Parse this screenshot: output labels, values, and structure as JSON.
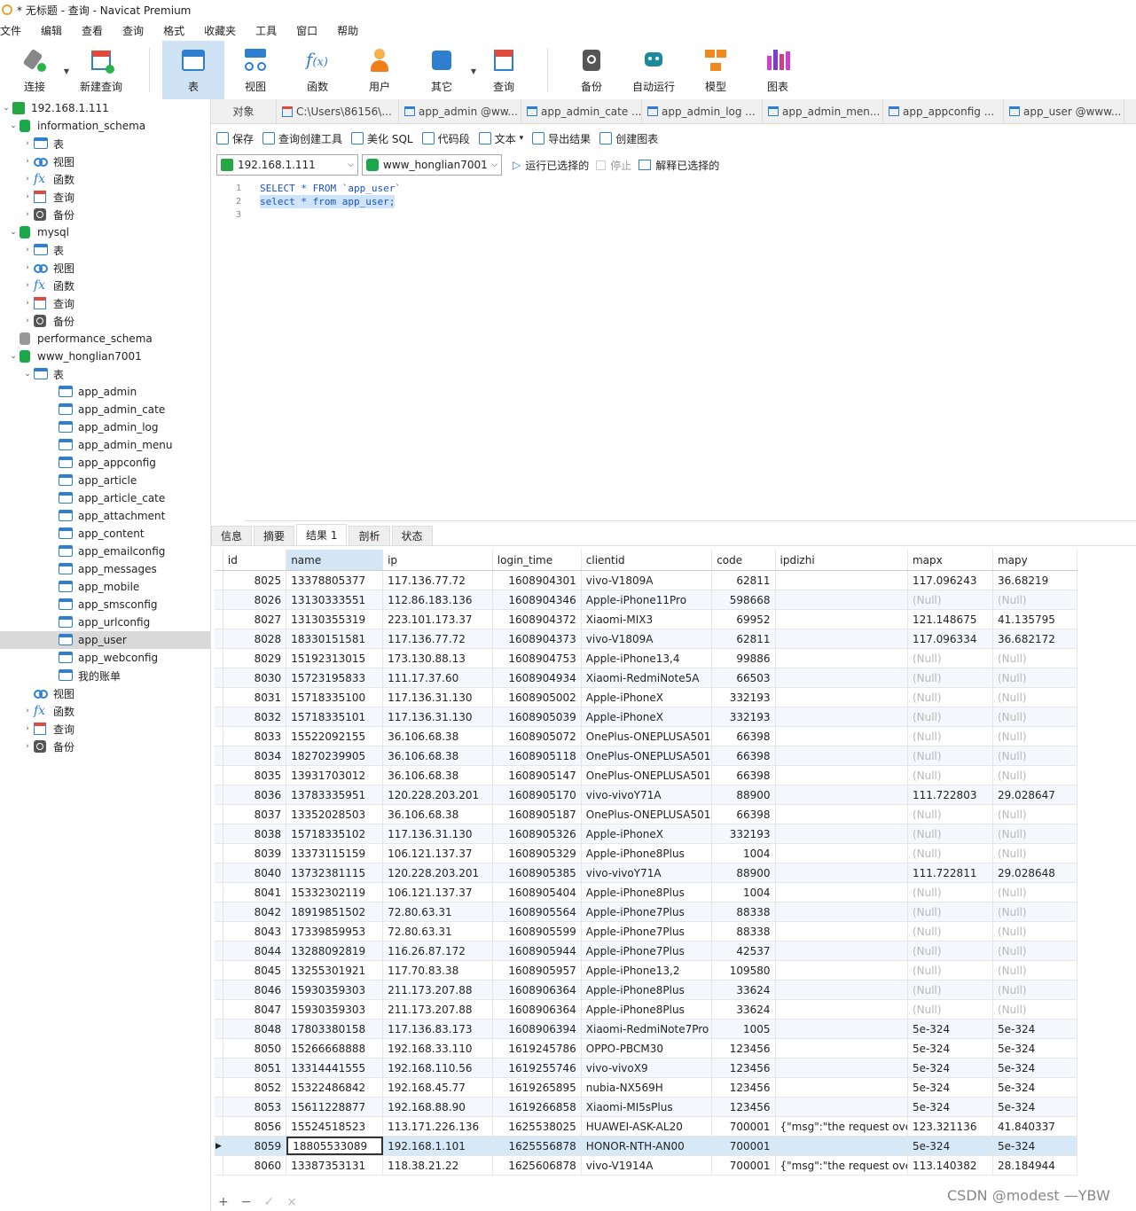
{
  "window": {
    "title": "* 无标题 - 查询 - Navicat Premium"
  },
  "menu": [
    "文件",
    "编辑",
    "查看",
    "查询",
    "格式",
    "收藏夹",
    "工具",
    "窗口",
    "帮助"
  ],
  "toolbar": [
    {
      "label": "连接",
      "icon": "connect-icon"
    },
    {
      "label": "新建查询",
      "icon": "new-query-icon"
    },
    {
      "label": "表",
      "icon": "table-icon"
    },
    {
      "label": "视图",
      "icon": "view-icon"
    },
    {
      "label": "函数",
      "icon": "function-icon"
    },
    {
      "label": "用户",
      "icon": "user-icon"
    },
    {
      "label": "其它",
      "icon": "tools-icon"
    },
    {
      "label": "查询",
      "icon": "query-icon"
    },
    {
      "label": "备份",
      "icon": "backup-icon"
    },
    {
      "label": "自动运行",
      "icon": "robot-icon"
    },
    {
      "label": "模型",
      "icon": "model-icon"
    },
    {
      "label": "图表",
      "icon": "chart-icon"
    }
  ],
  "sidebar": {
    "rows": [
      "192.168.1.111",
      "information_schema",
      "表",
      "视图",
      "函数",
      "查询",
      "备份",
      "mysql",
      "表",
      "视图",
      "函数",
      "查询",
      "备份",
      "performance_schema",
      "www_honglian7001",
      "表",
      "app_admin",
      "app_admin_cate",
      "app_admin_log",
      "app_admin_menu",
      "app_appconfig",
      "app_article",
      "app_article_cate",
      "app_attachment",
      "app_content",
      "app_emailconfig",
      "app_messages",
      "app_mobile",
      "app_smsconfig",
      "app_urlconfig",
      "app_user",
      "app_webconfig",
      "我的账单",
      "视图",
      "函数",
      "查询",
      "备份"
    ]
  },
  "tabs": [
    "对象",
    "C:\\Users\\86156\\...",
    "app_admin @ww...",
    "app_admin_cate ...",
    "app_admin_log ...",
    "app_admin_men...",
    "app_appconfig ...",
    "app_user @www..."
  ],
  "query_toolbar": [
    "保存",
    "查询创建工具",
    "美化 SQL",
    "代码段",
    "文本",
    "导出结果",
    "创建图表"
  ],
  "selectors": {
    "connection": "192.168.1.111",
    "database": "www_honglian7001"
  },
  "run": {
    "run_label": "运行已选择的",
    "stop_label": "停止",
    "explain_label": "解释已选择的"
  },
  "editor": {
    "line_numbers": [
      "1",
      "2",
      "3"
    ],
    "lines": [
      "SELECT * FROM `app_user`",
      "select * from app_user;",
      ""
    ]
  },
  "result_tabs": [
    "信息",
    "摘要",
    "结果 1",
    "剖析",
    "状态"
  ],
  "grid": {
    "columns": [
      "id",
      "name",
      "ip",
      "login_time",
      "clientid",
      "code",
      "ipdizhi",
      "mapx",
      "mapy"
    ],
    "rows": [
      [
        "8025",
        "13378805377",
        "117.136.77.72",
        "1608904301",
        "vivo-V1809A",
        "62811",
        "",
        "117.096243",
        "36.68219"
      ],
      [
        "8026",
        "13130333551",
        "112.86.183.136",
        "1608904346",
        "Apple-iPhone11Pro",
        "598668",
        "",
        "(Null)",
        "(Null)"
      ],
      [
        "8027",
        "13130355319",
        "223.101.173.37",
        "1608904372",
        "Xiaomi-MIX3",
        "69952",
        "",
        "121.148675",
        "41.135795"
      ],
      [
        "8028",
        "18330151581",
        "117.136.77.72",
        "1608904373",
        "vivo-V1809A",
        "62811",
        "",
        "117.096334",
        "36.682172"
      ],
      [
        "8029",
        "15192313015",
        "173.130.88.13",
        "1608904753",
        "Apple-iPhone13,4",
        "99886",
        "",
        "(Null)",
        "(Null)"
      ],
      [
        "8030",
        "15723195833",
        "111.17.37.60",
        "1608904934",
        "Xiaomi-RedmiNote5A",
        "66503",
        "",
        "(Null)",
        "(Null)"
      ],
      [
        "8031",
        "15718335100",
        "117.136.31.130",
        "1608905002",
        "Apple-iPhoneX",
        "332193",
        "",
        "(Null)",
        "(Null)"
      ],
      [
        "8032",
        "15718335101",
        "117.136.31.130",
        "1608905039",
        "Apple-iPhoneX",
        "332193",
        "",
        "(Null)",
        "(Null)"
      ],
      [
        "8033",
        "15522092155",
        "36.106.68.38",
        "1608905072",
        "OnePlus-ONEPLUSA501",
        "66398",
        "",
        "(Null)",
        "(Null)"
      ],
      [
        "8034",
        "18270239905",
        "36.106.68.38",
        "1608905118",
        "OnePlus-ONEPLUSA501",
        "66398",
        "",
        "(Null)",
        "(Null)"
      ],
      [
        "8035",
        "13931703012",
        "36.106.68.38",
        "1608905147",
        "OnePlus-ONEPLUSA501",
        "66398",
        "",
        "(Null)",
        "(Null)"
      ],
      [
        "8036",
        "13783335951",
        "120.228.203.201",
        "1608905170",
        "vivo-vivoY71A",
        "88900",
        "",
        "111.722803",
        "29.028647"
      ],
      [
        "8037",
        "13352028503",
        "36.106.68.38",
        "1608905187",
        "OnePlus-ONEPLUSA501",
        "66398",
        "",
        "(Null)",
        "(Null)"
      ],
      [
        "8038",
        "15718335102",
        "117.136.31.130",
        "1608905326",
        "Apple-iPhoneX",
        "332193",
        "",
        "(Null)",
        "(Null)"
      ],
      [
        "8039",
        "13373115159",
        "106.121.137.37",
        "1608905329",
        "Apple-iPhone8Plus",
        "1004",
        "",
        "(Null)",
        "(Null)"
      ],
      [
        "8040",
        "13732381115",
        "120.228.203.201",
        "1608905385",
        "vivo-vivoY71A",
        "88900",
        "",
        "111.722811",
        "29.028648"
      ],
      [
        "8041",
        "15332302119",
        "106.121.137.37",
        "1608905404",
        "Apple-iPhone8Plus",
        "1004",
        "",
        "(Null)",
        "(Null)"
      ],
      [
        "8042",
        "18919851502",
        "72.80.63.31",
        "1608905564",
        "Apple-iPhone7Plus",
        "88338",
        "",
        "(Null)",
        "(Null)"
      ],
      [
        "8043",
        "17339859953",
        "72.80.63.31",
        "1608905599",
        "Apple-iPhone7Plus",
        "88338",
        "",
        "(Null)",
        "(Null)"
      ],
      [
        "8044",
        "13288092819",
        "116.26.87.172",
        "1608905944",
        "Apple-iPhone7Plus",
        "42537",
        "",
        "(Null)",
        "(Null)"
      ],
      [
        "8045",
        "13255301921",
        "117.70.83.38",
        "1608905957",
        "Apple-iPhone13,2",
        "109580",
        "",
        "(Null)",
        "(Null)"
      ],
      [
        "8046",
        "15930359303",
        "211.173.207.88",
        "1608906364",
        "Apple-iPhone8Plus",
        "33624",
        "",
        "(Null)",
        "(Null)"
      ],
      [
        "8047",
        "15930359303",
        "211.173.207.88",
        "1608906364",
        "Apple-iPhone8Plus",
        "33624",
        "",
        "(Null)",
        "(Null)"
      ],
      [
        "8048",
        "17803380158",
        "117.136.83.173",
        "1608906394",
        "Xiaomi-RedmiNote7Pro",
        "1005",
        "",
        "5e-324",
        "5e-324"
      ],
      [
        "8050",
        "15266668888",
        "192.168.33.110",
        "1619245786",
        "OPPO-PBCM30",
        "123456",
        "",
        "5e-324",
        "5e-324"
      ],
      [
        "8051",
        "13314441555",
        "192.168.110.56",
        "1619255746",
        "vivo-vivoX9",
        "123456",
        "",
        "5e-324",
        "5e-324"
      ],
      [
        "8052",
        "15322486842",
        "192.168.45.77",
        "1619265895",
        "nubia-NX569H",
        "123456",
        "",
        "5e-324",
        "5e-324"
      ],
      [
        "8053",
        "15611228877",
        "192.168.88.90",
        "1619266858",
        "Xiaomi-MI5sPlus",
        "123456",
        "",
        "5e-324",
        "5e-324"
      ],
      [
        "8056",
        "15524518523",
        "113.171.226.136",
        "1625538025",
        "HUAWEI-ASK-AL20",
        "700001",
        "{\"msg\":\"the request over",
        "123.321136",
        "41.840337"
      ],
      [
        "8059",
        "18805533089",
        "192.168.1.101",
        "1625556878",
        "HONOR-NTH-AN00",
        "700001",
        "",
        "5e-324",
        "5e-324"
      ],
      [
        "8060",
        "13387353131",
        "118.38.21.22",
        "1625606878",
        "vivo-V1914A",
        "700001",
        "{\"msg\":\"the request over",
        "113.140382",
        "28.184944"
      ]
    ]
  },
  "status_buttons": [
    "+",
    "−",
    "✓",
    "×"
  ],
  "watermark": "CSDN @modest —YBW"
}
